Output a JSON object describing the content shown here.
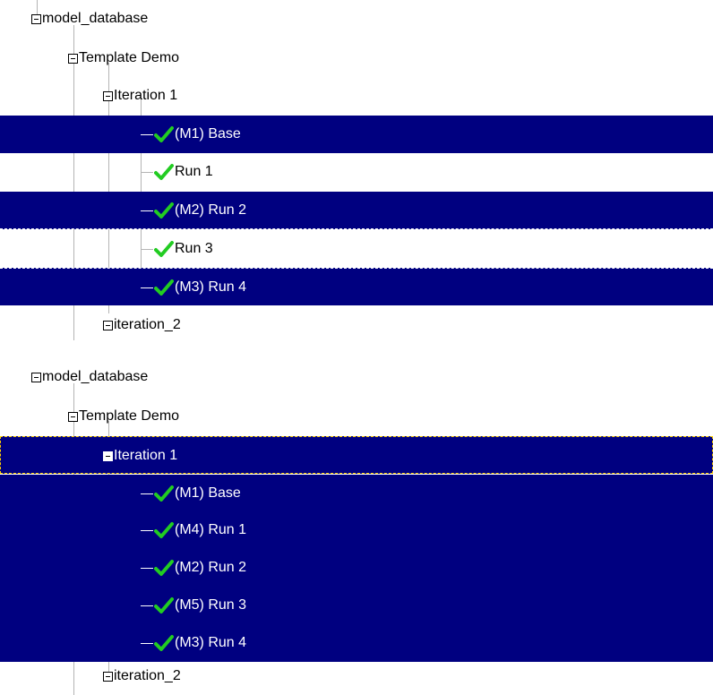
{
  "tree1": {
    "root": "model_database",
    "project": "Template Demo",
    "iteration1": "Iteration 1",
    "runs": [
      {
        "label": "(M1) Base",
        "selected": true
      },
      {
        "label": "Run 1",
        "selected": false
      },
      {
        "label": "(M2) Run 2",
        "selected": true
      },
      {
        "label": "Run 3",
        "selected": false
      },
      {
        "label": "(M3) Run 4",
        "selected": true
      }
    ],
    "iteration2": "iteration_2"
  },
  "tree2": {
    "root": "model_database",
    "project": "Template Demo",
    "iteration1": "Iteration 1",
    "runs": [
      {
        "label": "(M1) Base",
        "selected": true
      },
      {
        "label": "(M4) Run 1",
        "selected": true
      },
      {
        "label": "(M2) Run 2",
        "selected": true
      },
      {
        "label": "(M5) Run 3",
        "selected": true
      },
      {
        "label": "(M3) Run 4",
        "selected": true
      }
    ],
    "iteration2": "iteration_2"
  },
  "colors": {
    "selection": "#000080",
    "check": "#22cc22",
    "focus_outline": "#ffd000"
  },
  "icons": {
    "expander": "collapse-minus-icon",
    "run_status": "checkmark-icon"
  }
}
